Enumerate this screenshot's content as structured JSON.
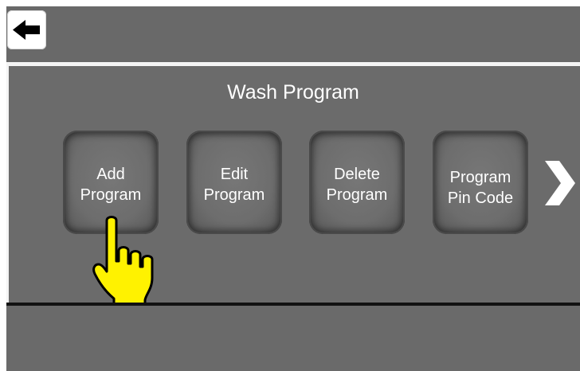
{
  "header": {
    "back_button": {
      "icon": "arrow-left-icon",
      "label": ""
    }
  },
  "main": {
    "title": "Wash Program",
    "buttons": [
      {
        "id": "add-program",
        "label": "Add\nProgram"
      },
      {
        "id": "edit-program",
        "label": "Edit\nProgram"
      },
      {
        "id": "delete-program",
        "label": "Delete\nProgram"
      },
      {
        "id": "program-pin-code",
        "label": "Program\nPin Code"
      }
    ],
    "next": {
      "icon": "chevron-right-icon"
    },
    "pointer": {
      "icon": "pointing-hand-icon",
      "target": "Add Program"
    }
  },
  "colors": {
    "background": "#6b6b6b",
    "divider_light": "#f4f4f4",
    "divider_dark": "#111111",
    "text": "#ffffff",
    "pointer_fill": "#fff200",
    "pointer_outline": "#000000"
  }
}
